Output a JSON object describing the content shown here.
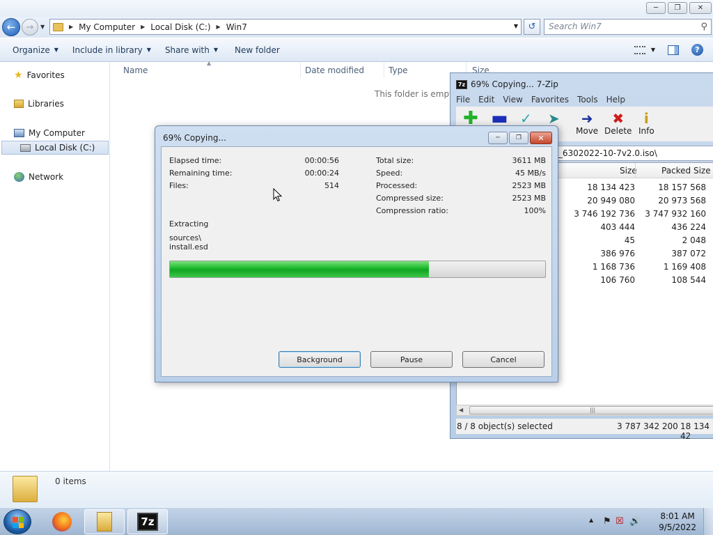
{
  "explorer": {
    "breadcrumb": [
      "My Computer",
      "Local Disk (C:)",
      "Win7"
    ],
    "search_placeholder": "Search Win7",
    "commands": [
      "Organize",
      "Include in library",
      "Share with",
      "New folder"
    ],
    "nav": {
      "favorites": "Favorites",
      "libraries": "Libraries",
      "my_computer": "My Computer",
      "local_disk": "Local Disk (C:)",
      "network": "Network"
    },
    "columns": [
      "Name",
      "Date modified",
      "Type",
      "Size"
    ],
    "empty_message": "This folder is empty.",
    "item_count": "0 items"
  },
  "sevenzip": {
    "title": "69% Copying... 7-Zip",
    "menu": [
      "File",
      "Edit",
      "View",
      "Favorites",
      "Tools",
      "Help"
    ],
    "toolbar": [
      {
        "label": "",
        "icon": "plus-icon",
        "color": "#22b22b"
      },
      {
        "label": "",
        "icon": "minus-icon",
        "color": "#1b2fb8"
      },
      {
        "label": "",
        "icon": "checkmark-icon",
        "color": "#2aa6b0"
      },
      {
        "label": "py",
        "icon": "copy-arrow-icon",
        "color": "#2a8a8a"
      },
      {
        "label": "Move",
        "icon": "move-arrow-icon",
        "color": "#1b2f9c"
      },
      {
        "label": "Delete",
        "icon": "delete-x-icon",
        "color": "#d01c1c"
      },
      {
        "label": "Info",
        "icon": "info-icon",
        "color": "#c8a000"
      }
    ],
    "path": "rprise_6.1.7746_amd64_6302022-10-7v2.0.iso\\",
    "columns": [
      "Size",
      "Packed Size"
    ],
    "rows": [
      {
        "size": "18 134 423",
        "packed": "18 157 568"
      },
      {
        "size": "20 949 080",
        "packed": "20 973 568"
      },
      {
        "size": "3 746 192 736",
        "packed": "3 747 932 160"
      },
      {
        "size": "403 444",
        "packed": "436 224"
      },
      {
        "size": "45",
        "packed": "2 048"
      },
      {
        "size": "386 976",
        "packed": "387 072"
      },
      {
        "size": "1 168 736",
        "packed": "1 169 408"
      },
      {
        "size": "106 760",
        "packed": "108 544"
      }
    ],
    "status": {
      "selected": "8 / 8 object(s) selected",
      "total_size": "3 787 342 200",
      "total_packed": "18 134 42"
    }
  },
  "dialog": {
    "title": "69% Copying...",
    "elapsed_label": "Elapsed time:",
    "elapsed": "00:00:56",
    "remaining_label": "Remaining time:",
    "remaining": "00:00:24",
    "files_label": "Files:",
    "files": "514",
    "total_size_label": "Total size:",
    "total_size": "3611 MB",
    "speed_label": "Speed:",
    "speed": "45 MB/s",
    "processed_label": "Processed:",
    "processed": "2523 MB",
    "compressed_label": "Compressed size:",
    "compressed": "2523 MB",
    "ratio_label": "Compression ratio:",
    "ratio": "100%",
    "operation": "Extracting",
    "current_dir": "sources\\",
    "current_file": "install.esd",
    "progress_percent": 69,
    "buttons": {
      "background": "Background",
      "pause": "Pause",
      "cancel": "Cancel"
    }
  },
  "taskbar": {
    "time": "8:01 AM",
    "date": "9/5/2022",
    "app_icons": [
      "firefox-icon",
      "explorer-icon",
      "7zip-icon"
    ]
  }
}
